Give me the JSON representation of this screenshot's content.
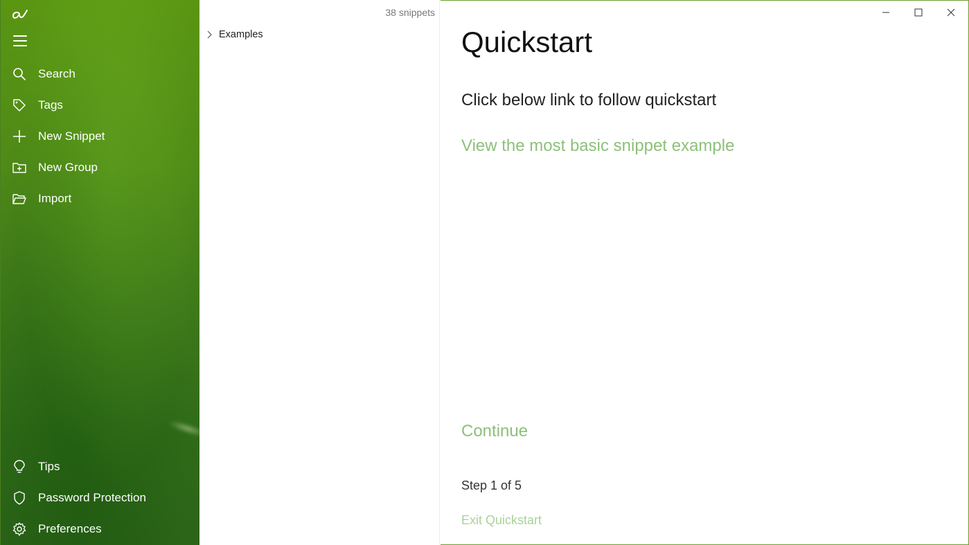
{
  "app": {
    "logo_icon": "handwritten-a-logo"
  },
  "sidebar": {
    "menu_icon": "hamburger-icon",
    "items_top": [
      {
        "label": "Search",
        "icon": "search-icon"
      },
      {
        "label": "Tags",
        "icon": "tag-icon"
      },
      {
        "label": "New Snippet",
        "icon": "plus-icon"
      },
      {
        "label": "New Group",
        "icon": "folder-plus-icon"
      },
      {
        "label": "Import",
        "icon": "folder-open-icon"
      }
    ],
    "items_bottom": [
      {
        "label": "Tips",
        "icon": "lightbulb-icon"
      },
      {
        "label": "Password Protection",
        "icon": "shield-icon"
      },
      {
        "label": "Preferences",
        "icon": "gear-icon"
      }
    ]
  },
  "list": {
    "count_label": "38 snippets",
    "groups": [
      {
        "label": "Examples",
        "icon": "chevron-right-icon"
      }
    ]
  },
  "window": {
    "minimize_icon": "minimize-icon",
    "maximize_icon": "maximize-icon",
    "close_icon": "close-icon"
  },
  "main": {
    "title": "Quickstart",
    "subtitle": "Click below link to follow quickstart",
    "link": "View the most basic snippet example",
    "continue": "Continue",
    "step": "Step 1 of 5",
    "exit": "Exit Quickstart"
  },
  "colors": {
    "accent": "#8dc07a",
    "sidebar": "#4f8b17"
  }
}
